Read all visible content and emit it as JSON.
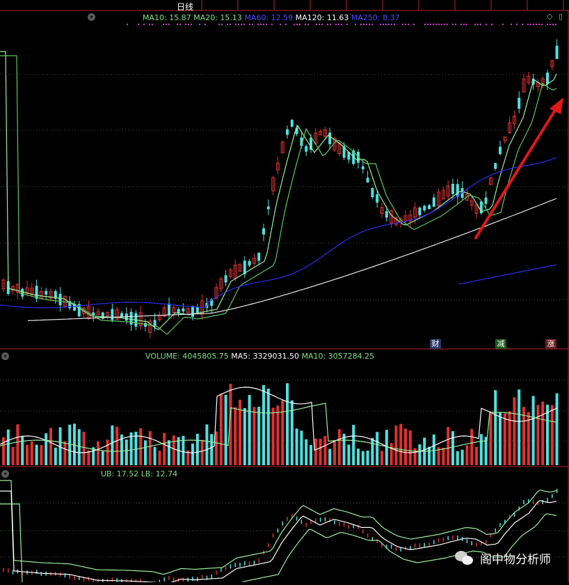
{
  "title": "日线",
  "main_legend": [
    {
      "label": "MA10: 15.87",
      "color": "#7ee07e"
    },
    {
      "label": "MA20: 15.13",
      "color": "#7ee07e"
    },
    {
      "label": "MA60: 12.59",
      "color": "#3a3aff"
    },
    {
      "label": "MA120: 11.63",
      "color": "#ffffff"
    },
    {
      "label": "MA250: 8.37",
      "color": "#3a3aff"
    }
  ],
  "volume_legend": [
    {
      "label": "VOLUME: 4045805.75",
      "color": "#7ee07e"
    },
    {
      "label": "MA5: 3329031.50",
      "color": "#ffffff"
    },
    {
      "label": "MA10: 3057284.25",
      "color": "#7ee07e"
    }
  ],
  "boll_legend": [
    {
      "label": "UB: 17.52",
      "color": "#7ee07e"
    },
    {
      "label": "LB: 12.74",
      "color": "#7ee07e"
    }
  ],
  "badges": [
    {
      "label": "财",
      "bg": "#2a3a6a"
    },
    {
      "label": "减",
      "bg": "#1e5a1e"
    },
    {
      "label": "涨",
      "bg": "#6a1e1e"
    }
  ],
  "watermark": "阁中物分析师",
  "colors": {
    "up": "#e03030",
    "down": "#4fe0e0",
    "ma10": "#9cf09c",
    "ma20": "#5ec85e",
    "ma60": "#2d2df0",
    "ma120": "#e8e8e8",
    "grid": "#555555",
    "arrow": "#e01818"
  },
  "chart_data": {
    "type": "candlestick",
    "indicators": [
      "MA10",
      "MA20",
      "MA60",
      "MA120",
      "MA250",
      "VOLUME",
      "MA5",
      "MA10",
      "UB",
      "LB"
    ]
  }
}
